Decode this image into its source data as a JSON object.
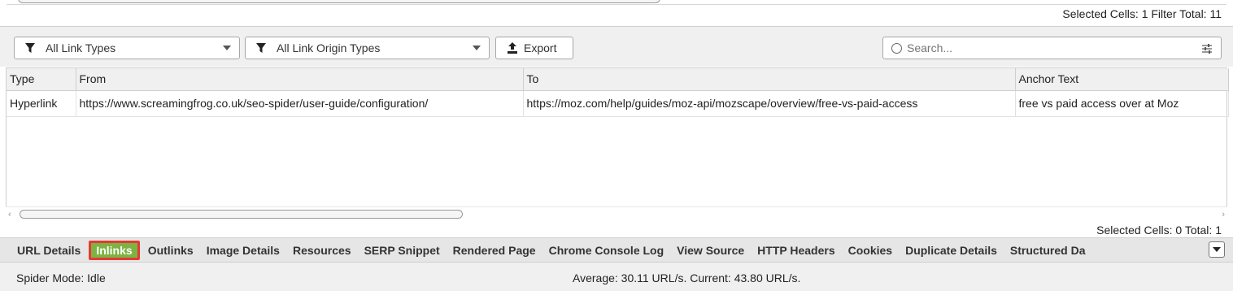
{
  "top_status": "Selected Cells:  1  Filter Total:  11",
  "toolbar": {
    "link_types_label": "All Link Types",
    "link_origin_label": "All Link Origin Types",
    "export_label": "Export",
    "search_placeholder": "Search..."
  },
  "table": {
    "headers": [
      "Type",
      "From",
      "To",
      "Anchor Text"
    ],
    "rows": [
      {
        "type": "Hyperlink",
        "from": "https://www.screamingfrog.co.uk/seo-spider/user-guide/configuration/",
        "to": "https://moz.com/help/guides/moz-api/mozscape/overview/free-vs-paid-access",
        "anchor": "free vs paid access over at Moz"
      }
    ]
  },
  "bottom_status": "Selected Cells:  0  Total:  1",
  "tabs": [
    {
      "label": "URL Details",
      "active": false
    },
    {
      "label": "Inlinks",
      "active": true
    },
    {
      "label": "Outlinks",
      "active": false
    },
    {
      "label": "Image Details",
      "active": false
    },
    {
      "label": "Resources",
      "active": false
    },
    {
      "label": "SERP Snippet",
      "active": false
    },
    {
      "label": "Rendered Page",
      "active": false
    },
    {
      "label": "Chrome Console Log",
      "active": false
    },
    {
      "label": "View Source",
      "active": false
    },
    {
      "label": "HTTP Headers",
      "active": false
    },
    {
      "label": "Cookies",
      "active": false
    },
    {
      "label": "Duplicate Details",
      "active": false
    },
    {
      "label": "Structured Da",
      "active": false
    }
  ],
  "footer": {
    "spider_mode": "Spider Mode: Idle",
    "rate": "Average: 30.11 URL/s. Current: 43.80 URL/s."
  },
  "icons": {
    "filter": "funnel-icon",
    "export": "upload-icon",
    "search": "search-icon",
    "tune": "sliders-icon",
    "more": "chevron-down-icon"
  },
  "colors": {
    "active_tab": "#7cb342",
    "highlight_border": "#e53935"
  }
}
